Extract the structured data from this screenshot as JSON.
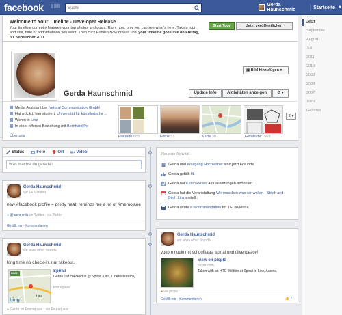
{
  "topbar": {
    "logo": "facebook",
    "search_placeholder": "Suche",
    "user_name": "Gerda Haunschmid",
    "home_label": "Startseite"
  },
  "welcome": {
    "title": "Welcome to Your Timeline - Developer Release",
    "text_part1": "Your timeline currently features your top photos and posts. Right now, only you can see what's here. Take a tour and star, hide or add whatever you want. Then click Publish Now or wait until ",
    "text_bold": "your timeline goes live on Freitag, 30. September 2011.",
    "start_tour": "Start Tour",
    "publish": "Jetzt veröffentlichen"
  },
  "profile": {
    "name": "Gerda Haunschmid",
    "add_photo": "Bild hinzufügen",
    "update_info": "Update Info",
    "activity_log": "Aktivitäten anzeigen",
    "settings": "⚙ ▾",
    "info": [
      {
        "pre": "Media Assistant bei ",
        "link": "Netural Communication GmbH",
        "post": ""
      },
      {
        "pre": "Hat m.k.k.t. hier studiert: ",
        "link": "Universität für künstlerische ...",
        "post": ""
      },
      {
        "pre": "Wohnt in ",
        "link": "Linz",
        "post": ""
      },
      {
        "pre": "In einer offenen Beziehung mit ",
        "link": "Bernhard Pe",
        "post": ""
      }
    ],
    "about": "Über uns",
    "tiles": [
      {
        "label": "Freunde",
        "count": "685"
      },
      {
        "label": "Fotos",
        "count": "52"
      },
      {
        "label": "Karte",
        "count": "38"
      },
      {
        "label": "„Gefällt mir“",
        "count": "569"
      }
    ],
    "more": "2 ▾"
  },
  "composer": {
    "tabs": [
      "Status",
      "Foto",
      "Ort",
      "Video"
    ],
    "placeholder": "Was machst du gerade?"
  },
  "recent": {
    "title": "Neueste Aktivität",
    "rows": [
      {
        "pre": "Gerda und ",
        "link": "Wolfgang Hochleitner",
        "post": " sind jetzt Freunde."
      },
      {
        "pre": "Gerda gefällt ",
        "link": "fit.",
        "post": ""
      },
      {
        "pre": "Gerda hat ",
        "link": "Kevin Roses",
        "post": " Aktualisierungen abonniert."
      },
      {
        "pre": "Gerda hat die Veranstaltung ",
        "link": "Wir maschen was wir wollen - Stitch and Bitch Linz",
        "post": " erstellt."
      },
      {
        "pre": "Gerda wrote ",
        "link": "a recommendation",
        "post": " for TEDxVienna."
      }
    ]
  },
  "posts": [
    {
      "author": "Gerda Haunschmid",
      "time": "vor 14 Minuten",
      "text": "new #facebook profile = pretty neat! reminds me a lot of #memolane",
      "source_pre": "@tschoerda",
      "source_post": " on Twitter · via Twitter",
      "foot": "Gefällt mir · Kommentieren"
    },
    {
      "author": "Gerda Haunschmid",
      "time": "vor etwa einer Stunde",
      "text": "long time no check-in. nur takeout.",
      "place_title": "Spirali",
      "place_text": "Gerda just checked in @ Spirali (Linz, Oberösterreich)",
      "place_source": "foursquare",
      "map_labels": [
        "B129",
        "Linz"
      ],
      "via": "Gerda on Foursquare · via Foursquare"
    },
    {
      "author": "Gerda Haunschmid",
      "time": "vor etwa einer Stunde",
      "text": "vukorn nuuln mit schoofkaas, spinat und olivenpeace!",
      "link_title": "View on picplz",
      "link_domain": "picplz.com",
      "link_desc": "Taken with an HTC Wildfire at Spirali in Linz, Austria.",
      "via": "via picplz",
      "foot": "Gefällt mir · Kommentieren",
      "likes": "2"
    }
  ],
  "scrubber": {
    "now": "Jetzt",
    "items": [
      "September",
      "August",
      "Juli",
      "2011",
      "2010",
      "2009",
      "2008",
      "2007",
      "1976",
      "Geboren"
    ]
  },
  "colors": {
    "brand": "#3b5998",
    "start_tour_green": "#69a74e"
  }
}
